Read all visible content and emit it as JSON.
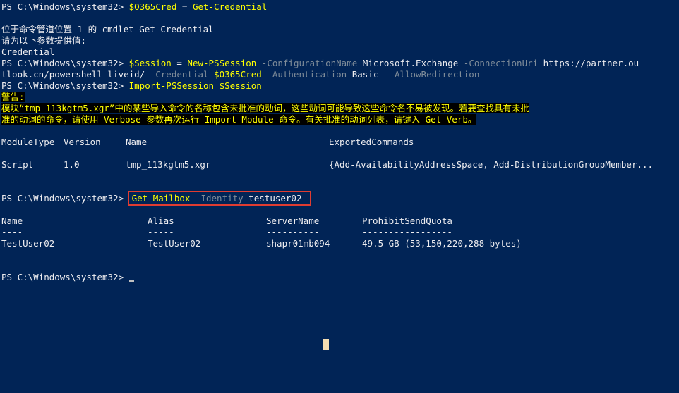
{
  "prompt": "PS C:\\Windows\\system32> ",
  "lines": {
    "l1_var": "$O365Cred",
    "l1_eq": " = ",
    "l1_cmd": "Get-Credential",
    "cred_msg1": "位于命令管道位置 1 的 cmdlet Get-Credential",
    "cred_msg2": "请为以下参数提供值:",
    "cred_msg3": "Credential",
    "l2_var": "$Session",
    "l2_eq": " = ",
    "l2_cmd": "New-PSSession",
    "l2_p1": " -ConfigurationName",
    "l2_v1": " Microsoft.Exchange",
    "l2_p2": " -ConnectionUri",
    "l2_v2a": " https://partner.ou",
    "l2_v2b": "tlook.cn/powershell-liveid/",
    "l2_p3": " -Credential",
    "l2_v3": " $O365Cred",
    "l2_p4": " -Authentication",
    "l2_v4": " Basic ",
    "l2_p5": " -AllowRedirection",
    "l3_cmd": "Import-PSSession",
    "l3_var": " $Session",
    "warn_title": "警告:",
    "warn_1": "模块“tmp_113kgtm5.xgr”中的某些导入命令的名称包含未批准的动词，这些动词可能导致这些命令名不易被发现。若要查找具有未批",
    "warn_2": "准的动词的命令，请使用 Verbose 参数再次运行 Import-Module 命令。有关批准的动词列表，请键入 Get-Verb。",
    "l4_cmd": "Get-Mailbox",
    "l4_p1": " -Identity",
    "l4_v1": " testuser02"
  },
  "module_table": {
    "headers": [
      "ModuleType",
      "Version",
      "Name",
      "ExportedCommands"
    ],
    "underlines": [
      "----------",
      "-------",
      "----",
      "----------------"
    ],
    "row": [
      "Script",
      "1.0",
      "tmp_113kgtm5.xgr",
      "{Add-AvailabilityAddressSpace, Add-DistributionGroupMember..."
    ]
  },
  "mailbox_table": {
    "headers": [
      "Name",
      "Alias",
      "ServerName",
      "ProhibitSendQuota"
    ],
    "underlines": [
      "----",
      "-----",
      "----------",
      "-----------------"
    ],
    "row": [
      "TestUser02",
      "TestUser02",
      "shapr01mb094",
      "49.5 GB (53,150,220,288 bytes)"
    ]
  },
  "colors": {
    "background": "#012456",
    "command": "#ffff00",
    "parameter": "#7f8c99",
    "text": "#eeedf0",
    "highlight_box": "#e03c31"
  }
}
